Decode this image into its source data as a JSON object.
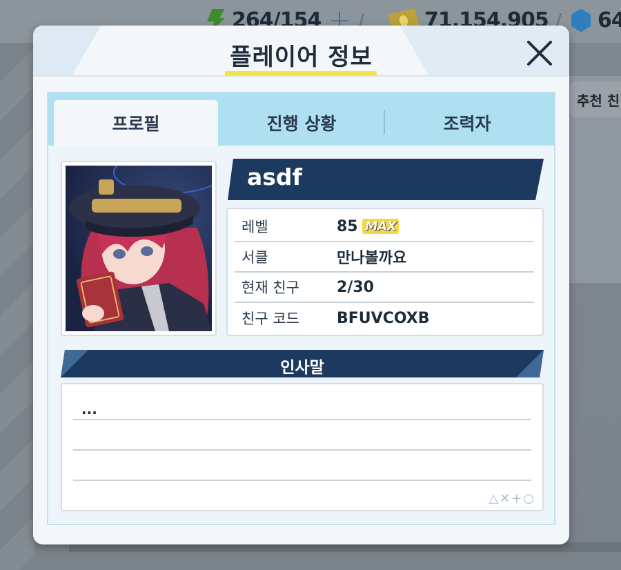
{
  "topbar": {
    "ap_value": "264/154",
    "credits_value": "71,154,905",
    "gems_value": "64"
  },
  "background": {
    "recommend_label": "추천 친"
  },
  "dialog": {
    "title": "플레이어 정보",
    "tabs": [
      {
        "label": "프로필",
        "active": true
      },
      {
        "label": "진행 상황",
        "active": false
      },
      {
        "label": "조력자",
        "active": false
      }
    ],
    "player_name": "asdf",
    "info": {
      "level_label": "레벨",
      "level_value": "85",
      "level_badge": "MAX",
      "circle_label": "서클",
      "circle_value": "만나볼까요",
      "friends_label": "현재 친구",
      "friends_value": "2/30",
      "friend_code_label": "친구 코드",
      "friend_code_value": "BFUVCOXB"
    },
    "greeting": {
      "title": "인사말",
      "text": "...",
      "shape_glyphs": "△✕+○"
    }
  },
  "colors": {
    "banner_navy": "#1c3a60",
    "tab_bar": "#aee0f2",
    "title_underline": "#f5e34a"
  }
}
